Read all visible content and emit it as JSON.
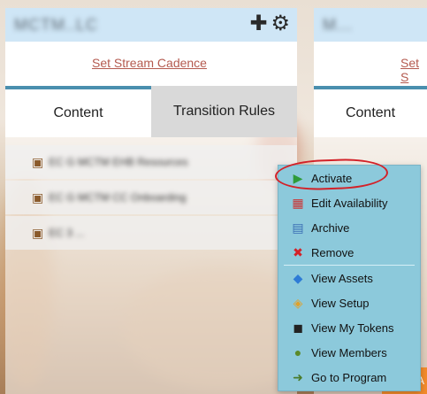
{
  "left_panel": {
    "title": "MCTM..LC",
    "cadence_link": "Set Stream Cadence",
    "tabs": [
      "Content",
      "Transition Rules"
    ],
    "programs": [
      "EC G MCTM EHB Resources",
      "EC G MCTM CC Onboarding",
      "EC 3 ..."
    ]
  },
  "right_panel": {
    "title": "M...",
    "cadence_link": "Set S",
    "tab": "Content"
  },
  "context_menu": {
    "items": [
      {
        "label": "Activate",
        "icon": "play-icon"
      },
      {
        "label": "Edit Availability",
        "icon": "calendar-icon"
      },
      {
        "label": "Archive",
        "icon": "archive-icon"
      },
      {
        "label": "Remove",
        "icon": "remove-icon"
      },
      {
        "label": "View Assets",
        "icon": "assets-icon"
      },
      {
        "label": "View Setup",
        "icon": "tag-icon"
      },
      {
        "label": "View My Tokens",
        "icon": "tokens-icon"
      },
      {
        "label": "View Members",
        "icon": "members-icon"
      },
      {
        "label": "Go to Program",
        "icon": "goto-icon"
      }
    ]
  },
  "colors": {
    "header_bg": "#cfe6f6",
    "menu_bg": "#8cc9db",
    "accent": "#4a8fae",
    "link": "#b45a4f",
    "highlight": "#d32128"
  }
}
